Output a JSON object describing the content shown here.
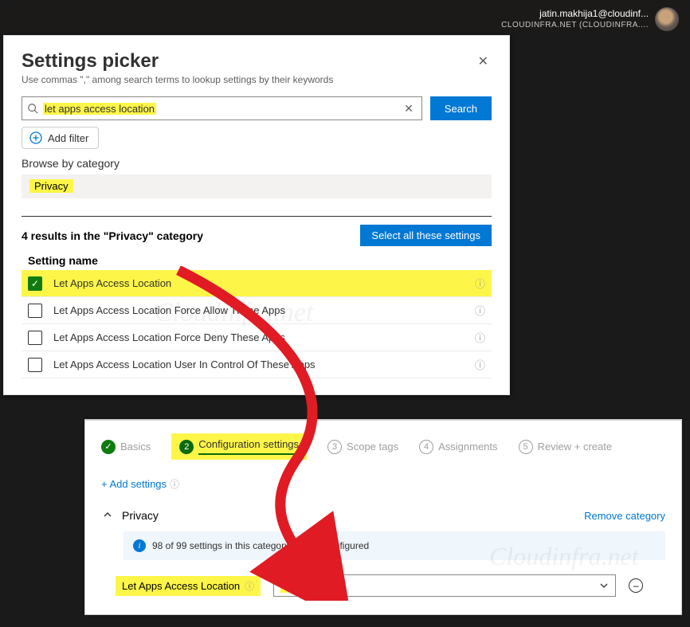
{
  "header": {
    "email": "jatin.makhija1@cloudinf...",
    "org": "CLOUDINFRA.NET (CLOUDINFRA...."
  },
  "picker": {
    "title": "Settings picker",
    "subtitle": "Use commas \",\" among search terms to lookup settings by their keywords",
    "search_value": "let apps access location",
    "search_button": "Search",
    "add_filter": "Add filter",
    "browse_label": "Browse by category",
    "category": "Privacy",
    "results_line": "4 results in the \"Privacy\" category",
    "select_all": "Select all these settings",
    "col_header": "Setting name",
    "rows": [
      {
        "label": "Let Apps Access Location",
        "checked": true,
        "highlight": true
      },
      {
        "label": "Let Apps Access Location Force Allow These Apps",
        "checked": false,
        "highlight": false
      },
      {
        "label": "Let Apps Access Location Force Deny These Apps",
        "checked": false,
        "highlight": false
      },
      {
        "label": "Let Apps Access Location User In Control Of These Apps",
        "checked": false,
        "highlight": false
      }
    ]
  },
  "config": {
    "tabs": {
      "basics": "Basics",
      "config": "Configuration settings",
      "scope": "Scope tags",
      "assign": "Assignments",
      "review": "Review + create",
      "step_config": "2",
      "step_scope": "3",
      "step_assign": "4",
      "step_review": "5"
    },
    "add_settings": "+ Add settings",
    "category": "Privacy",
    "remove_category": "Remove category",
    "info_msg": "98 of 99 settings in this category are not configured",
    "setting_label": "Let Apps Access Location",
    "setting_value": "Force allow."
  },
  "watermark": "Cloudinfra.net"
}
